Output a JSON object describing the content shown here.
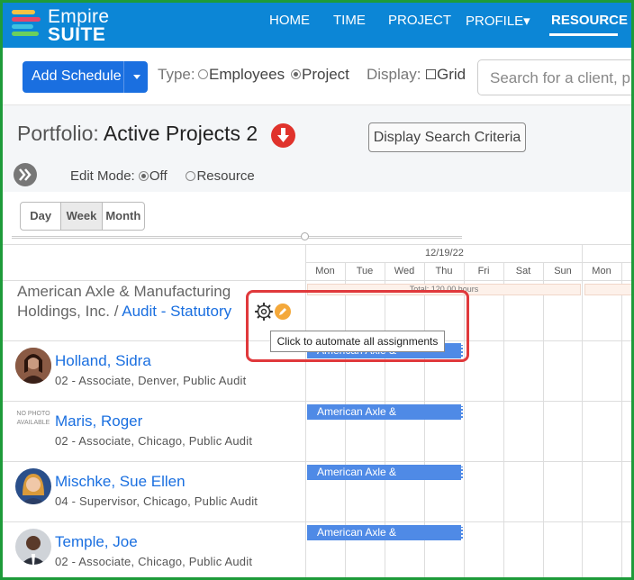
{
  "brand": {
    "line1": "Empire",
    "line2": "SUITE"
  },
  "nav": {
    "home": "HOME",
    "time": "TIME",
    "project": "PROJECT",
    "profile": "PROFILE▾",
    "resource": "RESOURCE"
  },
  "toolbar": {
    "add_schedule": "Add Schedule",
    "type_label": "Type:",
    "type_employees": "Employees",
    "type_project": "Project",
    "display_label": "Display:",
    "display_grid": "Grid",
    "search_placeholder": "Search for a client, p"
  },
  "portfolio": {
    "label": "Portfolio:",
    "value": "Active Projects 2",
    "display_search_criteria": "Display Search Criteria",
    "edit_mode_label": "Edit Mode:",
    "edit_off": "Off",
    "edit_resource": "Resource"
  },
  "view": {
    "day": "Day",
    "week": "Week",
    "month": "Month"
  },
  "grid": {
    "week_label": "12/19/22",
    "days": [
      "Mon",
      "Tue",
      "Wed",
      "Thu",
      "Fri",
      "Sat",
      "Sun",
      "Mon"
    ],
    "client_line1": "American Axle & Manufacturing",
    "client_line2": "Holdings, Inc. /",
    "client_project": "Audit - Statutory",
    "total_hours": "Total: 120.00 hours",
    "tooltip": "Click to automate all assignments"
  },
  "people": [
    {
      "name": "Holland, Sidra",
      "sub": "02 - Associate, Denver, Public Audit",
      "assignment": "American Axle &"
    },
    {
      "name": "Maris, Roger",
      "sub": "02 - Associate, Chicago, Public Audit",
      "assignment": "American Axle &",
      "nophoto": "NO PHOTO AVAILABLE"
    },
    {
      "name": "Mischke, Sue Ellen",
      "sub": "04 - Supervisor, Chicago, Public Audit",
      "assignment": "American Axle &"
    },
    {
      "name": "Temple, Joe",
      "sub": "02 - Associate, Chicago, Public Audit",
      "assignment": "American Axle &"
    }
  ],
  "colors": {
    "nav_bg": "#0c86d6",
    "primary_button": "#1a6fe0",
    "assignment_bar": "#4f8ae6",
    "highlight_border": "#e0393c",
    "frame_border": "#1e9b3a"
  }
}
